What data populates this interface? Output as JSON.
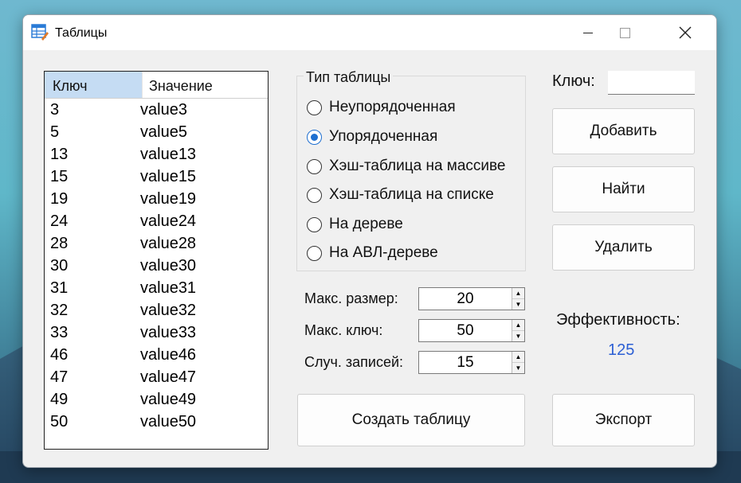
{
  "window": {
    "title": "Таблицы"
  },
  "table": {
    "columns": [
      "Ключ",
      "Значение"
    ],
    "rows": [
      [
        "3",
        "value3"
      ],
      [
        "5",
        "value5"
      ],
      [
        "13",
        "value13"
      ],
      [
        "15",
        "value15"
      ],
      [
        "19",
        "value19"
      ],
      [
        "24",
        "value24"
      ],
      [
        "28",
        "value28"
      ],
      [
        "30",
        "value30"
      ],
      [
        "31",
        "value31"
      ],
      [
        "32",
        "value32"
      ],
      [
        "33",
        "value33"
      ],
      [
        "46",
        "value46"
      ],
      [
        "47",
        "value47"
      ],
      [
        "49",
        "value49"
      ],
      [
        "50",
        "value50"
      ]
    ]
  },
  "table_type": {
    "title": "Тип таблицы",
    "selected_index": 1,
    "options": [
      "Неупорядоченная",
      "Упорядоченная",
      "Хэш-таблица на массиве",
      "Хэш-таблица на списке",
      "На дереве",
      "На АВЛ-дереве"
    ]
  },
  "settings": {
    "max_size": {
      "label": "Макс. размер:",
      "value": "20"
    },
    "max_key": {
      "label": "Макс. ключ:",
      "value": "50"
    },
    "random_records": {
      "label": "Случ. записей:",
      "value": "15"
    }
  },
  "buttons": {
    "create": "Создать таблицу",
    "add": "Добавить",
    "find": "Найти",
    "delete": "Удалить",
    "export": "Экспорт"
  },
  "key_field": {
    "label": "Ключ:",
    "value": ""
  },
  "efficiency": {
    "label": "Эффективность:",
    "value": "125"
  },
  "colors": {
    "accent": "#1e6fd0",
    "efficiency_value": "#2c5fd4",
    "header_selected": "#c5dcf3"
  },
  "icons": [
    "table-app-icon",
    "minimize-icon",
    "maximize-icon",
    "close-icon"
  ]
}
